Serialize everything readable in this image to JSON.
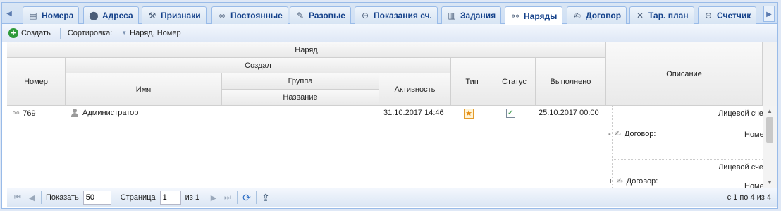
{
  "tabs": [
    {
      "label": "",
      "icon": "left-arrow"
    },
    {
      "label": "Номера",
      "icon": "document-icon"
    },
    {
      "label": "Адреса",
      "icon": "pin-icon"
    },
    {
      "label": "Признаки",
      "icon": "tools-icon"
    },
    {
      "label": "Постоянные",
      "icon": "link-icon"
    },
    {
      "label": "Разовые",
      "icon": "wrench-icon"
    },
    {
      "label": "Показания сч.",
      "icon": "meter-icon"
    },
    {
      "label": "Задания",
      "icon": "tasks-icon"
    },
    {
      "label": "Наряды",
      "icon": "order-icon",
      "active": true
    },
    {
      "label": "Договор",
      "icon": "contract-icon"
    },
    {
      "label": "Тар. план",
      "icon": "tariff-icon"
    },
    {
      "label": "Счетчик",
      "icon": "counter-icon"
    },
    {
      "label": "",
      "icon": "right-arrow"
    }
  ],
  "toolbar": {
    "create_label": "Создать",
    "sort_label": "Сортировка:",
    "sort_value": "Наряд, Номер"
  },
  "grid": {
    "header": {
      "group_top": "Наряд",
      "number": "Номер",
      "created_by": "Создал",
      "name": "Имя",
      "group": "Группа",
      "group_name": "Название",
      "activity": "Активность",
      "type": "Тип",
      "status": "Статус",
      "done": "Выполнено",
      "description": "Описание"
    },
    "rows": [
      {
        "number": "769",
        "name": "Администратор",
        "activity": "31.10.2017 14:46",
        "done": "25.10.2017 00:00",
        "desc": [
          {
            "prefix": "-",
            "label": "Договор:",
            "right_top": "Лицевой сче",
            "right_bottom": "Номе"
          },
          {
            "prefix": "+",
            "label": "Договор:",
            "right_top": "Лицевой сче",
            "right_bottom": "Номе"
          }
        ]
      }
    ]
  },
  "paging": {
    "show_label": "Показать",
    "page_size": "50",
    "page_label": "Страница",
    "page": "1",
    "of_label": "из 1",
    "info": "с 1 по 4 из 4"
  }
}
